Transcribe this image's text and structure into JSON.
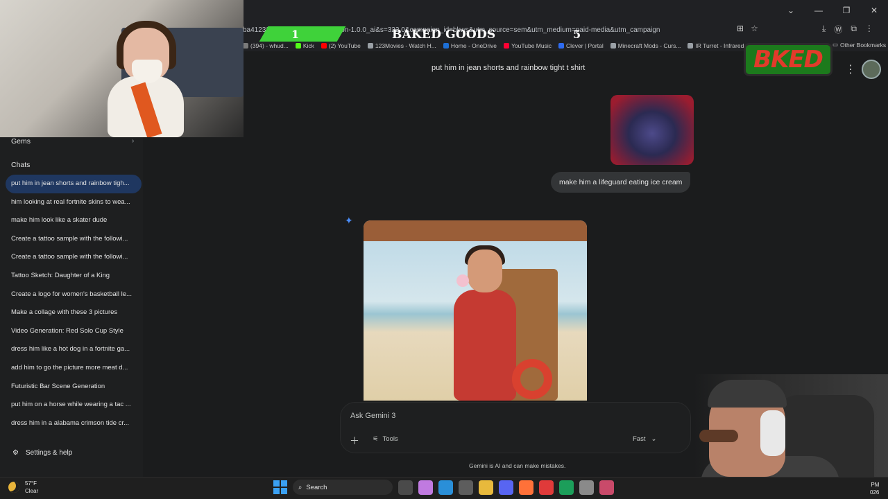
{
  "browser": {
    "url": "ba412322b8...android-min-version-1.0.0_ai&s=322.0&campaign_id=bkws&utm_source=sem&utm_medium=paid-media&utm_campaign",
    "bookmarks": [
      {
        "label": "(394) - whud...",
        "color": "#7a7a7a"
      },
      {
        "label": "Kick",
        "color": "#53fc18"
      },
      {
        "label": "(2) YouTube",
        "color": "#ff0000"
      },
      {
        "label": "123Movies - Watch H...",
        "color": "#9aa0a6"
      },
      {
        "label": "Home - OneDrive",
        "color": "#1d6fd6"
      },
      {
        "label": "YouTube Music",
        "color": "#ff0033"
      },
      {
        "label": "Clever | Portal",
        "color": "#2e6bf0"
      },
      {
        "label": "Minecraft Mods - Curs...",
        "color": "#9aa0a6"
      },
      {
        "label": "IR Turret - Infrared Co...",
        "color": "#9aa0a6"
      }
    ],
    "other_bookmarks": "Other Bookmarks"
  },
  "overlay": {
    "left_number": "1",
    "title": "BAKED GOODS",
    "right_number": "5",
    "logo_text": "BKED"
  },
  "sidebar": {
    "gems_label": "Gems",
    "chats_title": "Chats",
    "chats": [
      {
        "label": "put him in jean shorts and rainbow tigh...",
        "active": true
      },
      {
        "label": "him looking at real fortnite skins to wea..."
      },
      {
        "label": "make him look like a skater dude"
      },
      {
        "label": "Create a tattoo sample with the followi..."
      },
      {
        "label": "Create a tattoo sample with the followi..."
      },
      {
        "label": "Tattoo Sketch: Daughter of a King"
      },
      {
        "label": "Create a logo for women's basketball le..."
      },
      {
        "label": "Make a collage with these 3 pictures"
      },
      {
        "label": "Video Generation: Red Solo Cup Style"
      },
      {
        "label": "dress him like a hot dog in a fortnite ga..."
      },
      {
        "label": "add him to go the picture more meat d..."
      },
      {
        "label": "Futuristic Bar Scene Generation"
      },
      {
        "label": "put him on a horse while wearing a tac ..."
      },
      {
        "label": "dress him in a alabama crimson tide cr..."
      }
    ],
    "settings_label": "Settings & help"
  },
  "main": {
    "top_prompt": "put him in jean shorts and rainbow tight t shirt",
    "user_message": "make him a lifeguard eating ice cream",
    "input_placeholder": "Ask Gemini 3",
    "tools_label": "Tools",
    "mode_label": "Fast",
    "disclaimer": "Gemini is AI and can make mistakes."
  },
  "taskbar": {
    "temperature": "57°F",
    "condition": "Clear",
    "search_label": "Search",
    "time": "PM",
    "date": "026",
    "icons": [
      {
        "name": "task-view-icon",
        "color": "#4a4a4a"
      },
      {
        "name": "copilot-icon",
        "color": "#c07ae0"
      },
      {
        "name": "edge-icon",
        "color": "#2a8fd8"
      },
      {
        "name": "store-icon",
        "color": "#5d5d5d"
      },
      {
        "name": "file-explorer-icon",
        "color": "#e8b93c"
      },
      {
        "name": "discord-icon",
        "color": "#5865f2"
      },
      {
        "name": "firefox-icon",
        "color": "#ff7139"
      },
      {
        "name": "media-player-icon",
        "color": "#e03a3a"
      },
      {
        "name": "xbox-icon",
        "color": "#1c9e5a"
      },
      {
        "name": "settings-icon",
        "color": "#8a8a8a"
      },
      {
        "name": "snipping-tool-icon",
        "color": "#c94a6a"
      }
    ]
  }
}
